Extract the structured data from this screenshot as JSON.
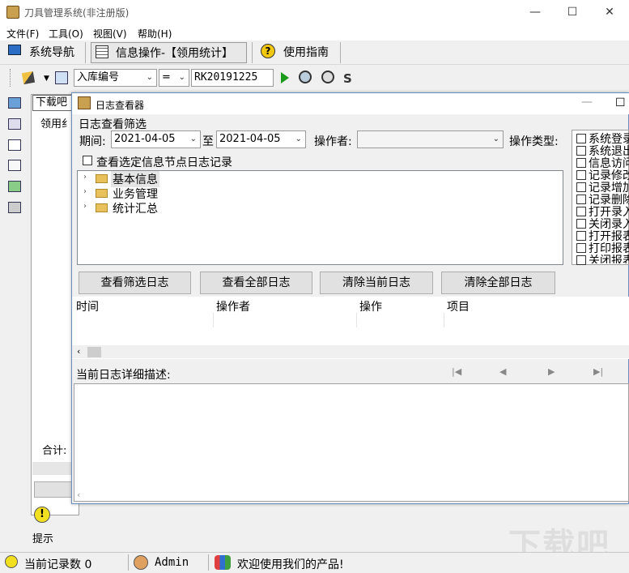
{
  "window": {
    "title": "刀具管理系统(非注册版)",
    "minimize": "—",
    "maximize": "☐",
    "close": "✕"
  },
  "menubar": [
    "文件(F)",
    "工具(O)",
    "视图(V)",
    "帮助(H)"
  ],
  "toolbar1": {
    "nav": "系统导航",
    "info_op": "信息操作-【领用统计】",
    "guide": "使用指南"
  },
  "toolbar2": {
    "field_select": "入库编号",
    "operator_select": "=",
    "value": "RK20191225"
  },
  "background_panel": {
    "tab": "下载吧",
    "col": "领用纟",
    "total": "合计:",
    "hint": "提示"
  },
  "dialog": {
    "title": "日志查看器",
    "filter_group": "日志查看筛选",
    "period_label": "期间:",
    "date_from": "2021-04-05",
    "to_label": "至",
    "date_to": "2021-04-05",
    "operator_label": "操作者:",
    "operator_value": "",
    "optype_label": "操作类型:",
    "check_selected_node": "查看选定信息节点日志记录",
    "tree": [
      "基本信息",
      "业务管理",
      "统计汇总"
    ],
    "op_types": [
      "系统登录",
      "系统退出",
      "信息访问",
      "记录修改",
      "记录增加",
      "记录删除",
      "打开录入",
      "关闭录入",
      "打开报表",
      "打印报表",
      "关闭报表"
    ],
    "buttons": {
      "view_filtered": "查看筛选日志",
      "view_all": "查看全部日志",
      "clear_current": "清除当前日志",
      "clear_all": "清除全部日志"
    },
    "columns": [
      "时间",
      "操作者",
      "操作",
      "项目"
    ],
    "detail_label": "当前日志详细描述:",
    "nav": {
      "first": "|◀",
      "prev": "◀",
      "next": "▶",
      "last": "▶|"
    }
  },
  "statusbar": {
    "record_count": "当前记录数 0",
    "user": "Admin",
    "welcome": "欢迎使用我们的产品!"
  },
  "watermark": "下载吧"
}
